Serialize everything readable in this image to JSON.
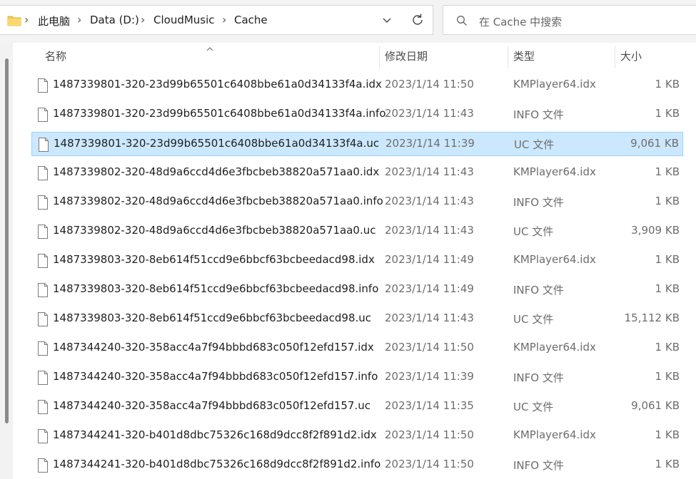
{
  "address_bar": {
    "breadcrumbs": [
      {
        "label": "此电脑"
      },
      {
        "label": "Data (D:)"
      },
      {
        "label": "CloudMusic"
      },
      {
        "label": "Cache"
      }
    ],
    "icons": {
      "folder": "folder-icon",
      "dropdown": "chevron-down-icon",
      "refresh": "refresh-icon",
      "separator": "chevron-right-icon"
    }
  },
  "search": {
    "placeholder": "在 Cache 中搜索",
    "icon": "search-icon"
  },
  "columns": {
    "name": "名称",
    "modified": "修改日期",
    "type": "类型",
    "size": "大小"
  },
  "sort": {
    "column": "name",
    "direction": "ascending"
  },
  "files": [
    {
      "name": "1487339801-320-23d99b65501c6408bbe61a0d34133f4a.idx",
      "modified": "2023/1/14 11:50",
      "type": "KMPlayer64.idx",
      "size": "1 KB"
    },
    {
      "name": "1487339801-320-23d99b65501c6408bbe61a0d34133f4a.info",
      "modified": "2023/1/14 11:43",
      "type": "INFO 文件",
      "size": "1 KB"
    },
    {
      "name": "1487339801-320-23d99b65501c6408bbe61a0d34133f4a.uc",
      "modified": "2023/1/14 11:39",
      "type": "UC 文件",
      "size": "9,061 KB",
      "selected": true
    },
    {
      "name": "1487339802-320-48d9a6ccd4d6e3fbcbeb38820a571aa0.idx",
      "modified": "2023/1/14 11:43",
      "type": "KMPlayer64.idx",
      "size": "1 KB"
    },
    {
      "name": "1487339802-320-48d9a6ccd4d6e3fbcbeb38820a571aa0.info",
      "modified": "2023/1/14 11:43",
      "type": "INFO 文件",
      "size": "1 KB"
    },
    {
      "name": "1487339802-320-48d9a6ccd4d6e3fbcbeb38820a571aa0.uc",
      "modified": "2023/1/14 11:43",
      "type": "UC 文件",
      "size": "3,909 KB"
    },
    {
      "name": "1487339803-320-8eb614f51ccd9e6bbcf63bcbeedacd98.idx",
      "modified": "2023/1/14 11:49",
      "type": "KMPlayer64.idx",
      "size": "1 KB"
    },
    {
      "name": "1487339803-320-8eb614f51ccd9e6bbcf63bcbeedacd98.info",
      "modified": "2023/1/14 11:49",
      "type": "INFO 文件",
      "size": "1 KB"
    },
    {
      "name": "1487339803-320-8eb614f51ccd9e6bbcf63bcbeedacd98.uc",
      "modified": "2023/1/14 11:43",
      "type": "UC 文件",
      "size": "15,112 KB"
    },
    {
      "name": "1487344240-320-358acc4a7f94bbbd683c050f12efd157.idx",
      "modified": "2023/1/14 11:50",
      "type": "KMPlayer64.idx",
      "size": "1 KB"
    },
    {
      "name": "1487344240-320-358acc4a7f94bbbd683c050f12efd157.info",
      "modified": "2023/1/14 11:39",
      "type": "INFO 文件",
      "size": "1 KB"
    },
    {
      "name": "1487344240-320-358acc4a7f94bbbd683c050f12efd157.uc",
      "modified": "2023/1/14 11:35",
      "type": "UC 文件",
      "size": "9,061 KB"
    },
    {
      "name": "1487344241-320-b401d8dbc75326c168d9dcc8f2f891d2.idx",
      "modified": "2023/1/14 11:50",
      "type": "KMPlayer64.idx",
      "size": "1 KB"
    },
    {
      "name": "1487344241-320-b401d8dbc75326c168d9dcc8f2f891d2.info",
      "modified": "2023/1/14 11:50",
      "type": "INFO 文件",
      "size": "1 KB"
    }
  ],
  "colors": {
    "selection_bg": "#cce8ff",
    "selection_border": "#99d1ff",
    "folder": "#f8c750"
  }
}
